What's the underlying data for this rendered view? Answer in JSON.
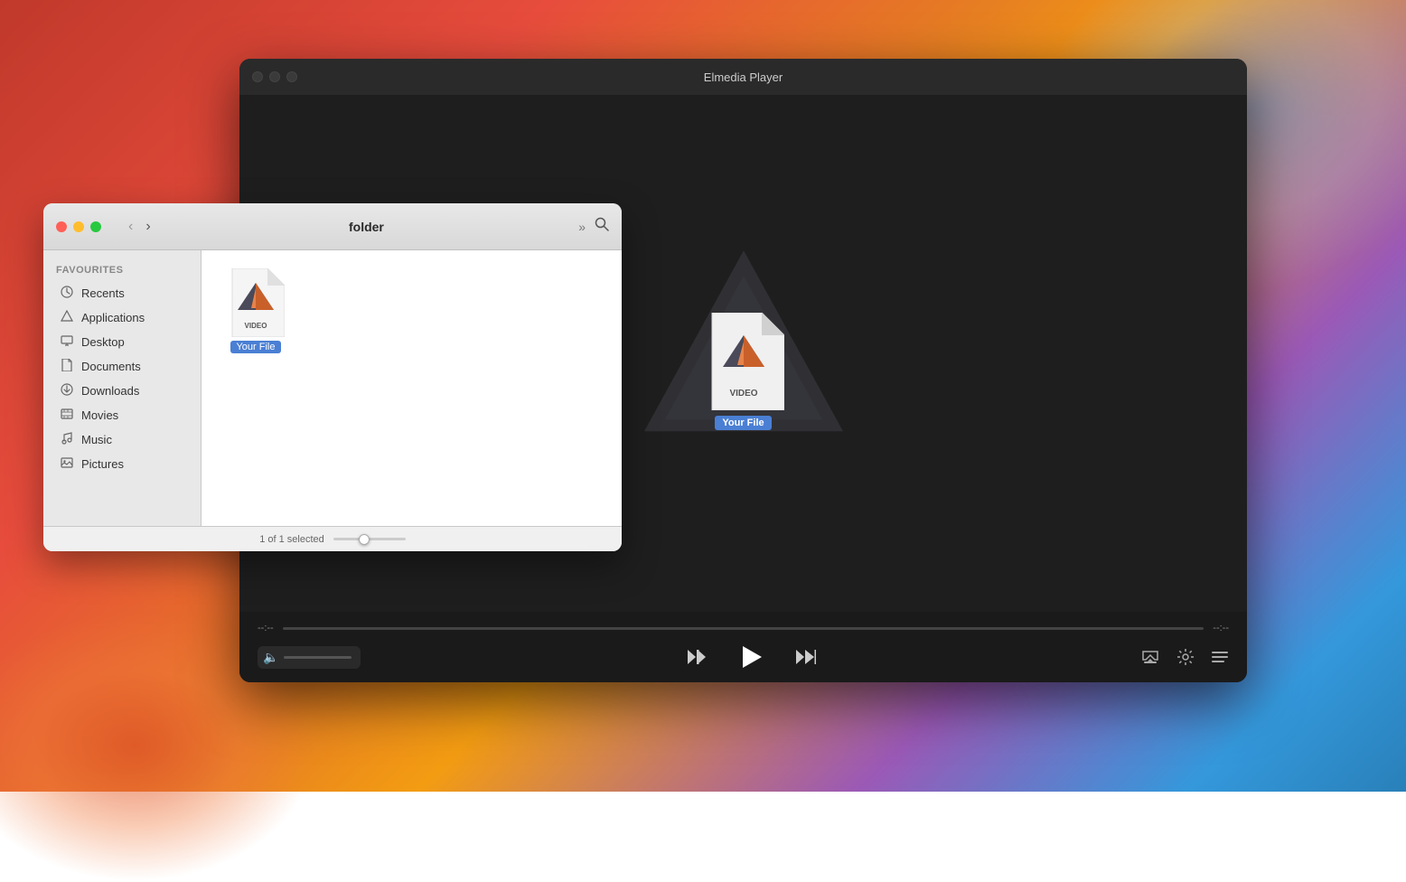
{
  "desktop": {
    "bg_description": "macOS desktop gradient background"
  },
  "player": {
    "title": "Elmedia Player",
    "traffic_lights": [
      "close",
      "minimize",
      "maximize"
    ],
    "file": {
      "label": "Your File",
      "type": "VIDEO"
    },
    "controls": {
      "time_start": "--:--",
      "time_end": "--:--",
      "prev_label": "previous",
      "play_label": "play",
      "next_label": "next",
      "airplay_label": "airplay",
      "settings_label": "settings",
      "playlist_label": "playlist"
    }
  },
  "finder": {
    "title": "folder",
    "sidebar": {
      "section_label": "Favourites",
      "items": [
        {
          "id": "recents",
          "label": "Recents",
          "icon": "🕐"
        },
        {
          "id": "applications",
          "label": "Applications",
          "icon": "🚀"
        },
        {
          "id": "desktop",
          "label": "Desktop",
          "icon": "🖥"
        },
        {
          "id": "documents",
          "label": "Documents",
          "icon": "📄"
        },
        {
          "id": "downloads",
          "label": "Downloads",
          "icon": "⬇"
        },
        {
          "id": "movies",
          "label": "Movies",
          "icon": "🎞"
        },
        {
          "id": "music",
          "label": "Music",
          "icon": "🎵"
        },
        {
          "id": "pictures",
          "label": "Pictures",
          "icon": "🖼"
        }
      ]
    },
    "file": {
      "label": "Your File",
      "type": "VIDEO"
    },
    "statusbar": {
      "selected_text": "1 of 1 selected"
    },
    "nav": {
      "back_label": "back",
      "forward_label": "forward",
      "more_label": "more views",
      "search_label": "search"
    }
  }
}
